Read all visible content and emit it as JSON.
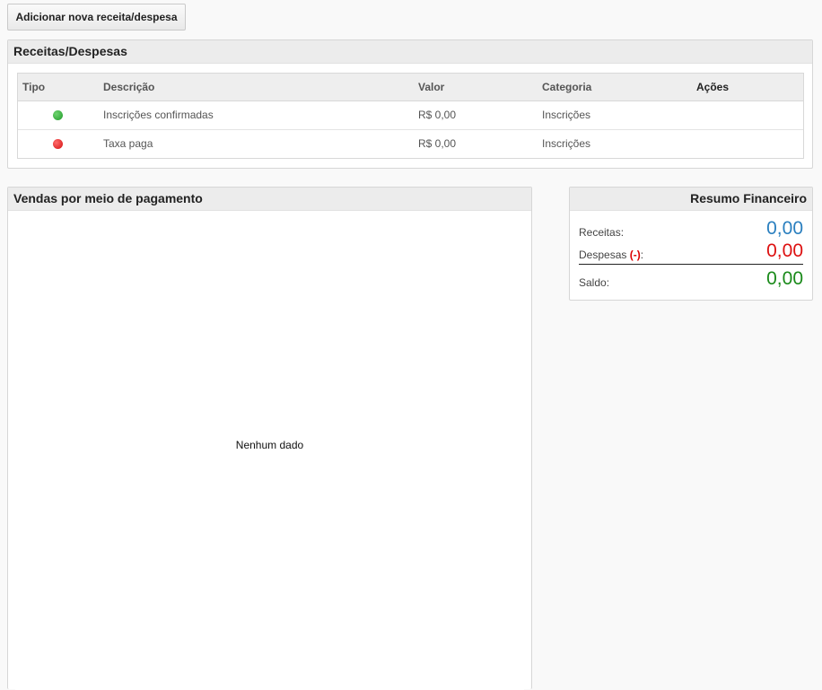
{
  "toolbar": {
    "add_label": "Adicionar nova receita/despesa"
  },
  "receitas_panel": {
    "title": "Receitas/Despesas",
    "columns": [
      "Tipo",
      "Descrição",
      "Valor",
      "Categoria",
      "Ações"
    ],
    "rows": [
      {
        "tipo": "receita",
        "tipo_color": "#2aa33a",
        "descricao": "Inscrições confirmadas",
        "valor": "R$ 0,00",
        "categoria": "Inscrições",
        "acoes": ""
      },
      {
        "tipo": "despesa",
        "tipo_color": "#e02020",
        "descricao": "Taxa paga",
        "valor": "R$ 0,00",
        "categoria": "Inscrições",
        "acoes": ""
      }
    ]
  },
  "vendas_panel": {
    "title": "Vendas por meio de pagamento",
    "empty_text": "Nenhum dado"
  },
  "resumo_panel": {
    "title": "Resumo Financeiro",
    "receitas_label": "Receitas:",
    "receitas_value": "0,00",
    "despesas_label": "Despesas",
    "despesas_sign": "(-)",
    "despesas_colon": ":",
    "despesas_value": "0,00",
    "saldo_label": "Saldo:",
    "saldo_value": "0,00",
    "colors": {
      "receitas": "#2a7fbf",
      "despesas": "#dd1111",
      "saldo": "#1a8a1a"
    }
  }
}
